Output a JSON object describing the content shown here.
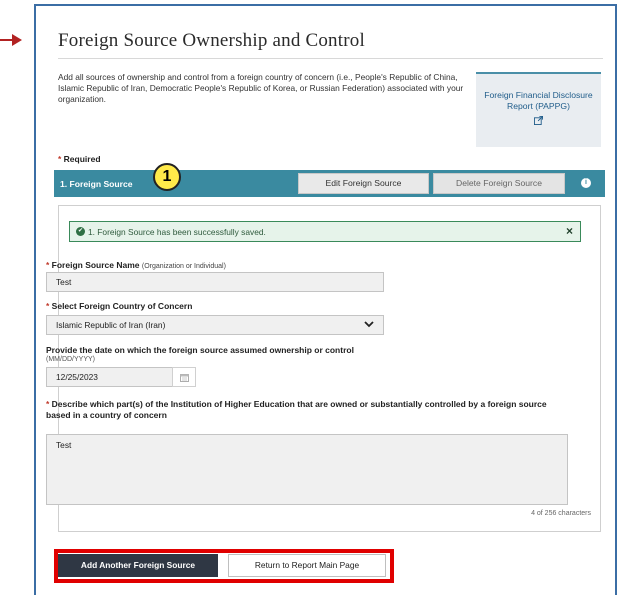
{
  "page": {
    "title": "Foreign Source Ownership and Control",
    "intro": "Add all sources of ownership and control from a foreign country of concern (i.e., People's Republic of China, Islamic Republic of Iran, Democratic People's Republic of Korea, or Russian Federation) associated with your organization.",
    "required_label": "Required"
  },
  "side_link": {
    "label": "Foreign Financial Disclosure Report (PAPPG)",
    "icon": "external-link-icon"
  },
  "section": {
    "label": "1. Foreign Source",
    "badge": "1",
    "edit_button": "Edit Foreign Source",
    "delete_button": "Delete Foreign Source",
    "info_icon": "info-icon"
  },
  "alert": {
    "message": "1. Foreign Source has been successfully saved.",
    "close": "×"
  },
  "form": {
    "name_label": "Foreign Source Name",
    "name_hint": "(Organization or Individual)",
    "name_value": "Test",
    "country_label": "Select Foreign Country of Concern",
    "country_value": "Islamic Republic of Iran (Iran)",
    "date_label": "Provide the date on which the foreign source assumed ownership or control",
    "date_hint": "(MM/DD/YYYY)",
    "date_value": "12/25/2023",
    "describe_label": "Describe which part(s) of the Institution of Higher Education that are owned or substantially controlled by a foreign source based in a country of concern",
    "describe_value": "Test",
    "char_count": "4 of 256 characters"
  },
  "actions": {
    "add_another": "Add Another Foreign Source",
    "return_main": "Return to Report Main Page"
  },
  "colors": {
    "section_bar": "#3a8aa0",
    "alert_border": "#3a8a5a",
    "highlight_frame": "#e00000",
    "arrow": "#b22222"
  }
}
